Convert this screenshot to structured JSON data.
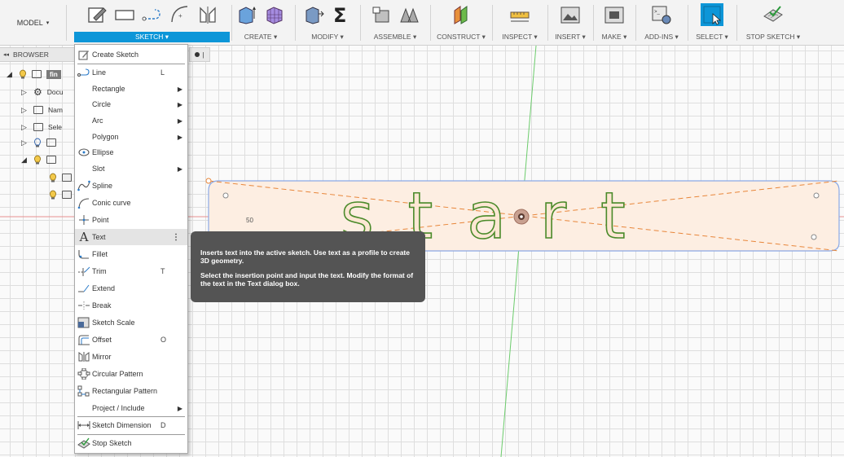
{
  "workspace": {
    "label": "MODEL",
    "arrow": "▾"
  },
  "toolbar": {
    "groups": [
      {
        "label": "SKETCH ▾",
        "icons": [
          "create-sketch-icon",
          "rectangle-icon",
          "line-icon",
          "arc-icon",
          "mirror-icon"
        ]
      },
      {
        "label": "CREATE ▾",
        "icons": [
          "extrude-icon",
          "box-grid-icon"
        ]
      },
      {
        "label": "MODIFY ▾",
        "icons": [
          "press-pull-icon",
          "sigma-icon"
        ]
      },
      {
        "label": "ASSEMBLE ▾",
        "icons": [
          "new-component-icon",
          "joint-icon"
        ]
      },
      {
        "label": "CONSTRUCT ▾",
        "icons": [
          "offset-plane-icon"
        ]
      },
      {
        "label": "INSPECT ▾",
        "icons": [
          "measure-icon"
        ]
      },
      {
        "label": "INSERT ▾",
        "icons": [
          "insert-image-icon"
        ]
      },
      {
        "label": "MAKE ▾",
        "icons": [
          "print-3d-icon"
        ]
      },
      {
        "label": "ADD-INS ▾",
        "icons": [
          "scripts-icon"
        ]
      },
      {
        "label": "SELECT ▾",
        "icons": [
          "select-icon"
        ]
      },
      {
        "label": "STOP SKETCH ▾",
        "icons": [
          "stop-sketch-icon"
        ]
      }
    ],
    "colors": {
      "active": "#0d96d8",
      "select_blue": "#0d96d8"
    }
  },
  "browser": {
    "title": "BROWSER",
    "collapse_glyph": "◂◂",
    "root_label": "fin",
    "items": [
      {
        "label": "Docu",
        "icon": "gear-icon"
      },
      {
        "label": "Nam",
        "icon": "folder-icon"
      },
      {
        "label": "Sele",
        "icon": "folder-icon"
      }
    ]
  },
  "menu": {
    "items": [
      {
        "label": "Create Sketch",
        "key": "",
        "submenu": false
      },
      {
        "label": "Line",
        "key": "L",
        "submenu": false
      },
      {
        "label": "Rectangle",
        "key": "",
        "submenu": true
      },
      {
        "label": "Circle",
        "key": "",
        "submenu": true
      },
      {
        "label": "Arc",
        "key": "",
        "submenu": true
      },
      {
        "label": "Polygon",
        "key": "",
        "submenu": true
      },
      {
        "label": "Ellipse",
        "key": "",
        "submenu": false
      },
      {
        "label": "Slot",
        "key": "",
        "submenu": true
      },
      {
        "label": "Spline",
        "key": "",
        "submenu": false
      },
      {
        "label": "Conic curve",
        "key": "",
        "submenu": false
      },
      {
        "label": "Point",
        "key": "",
        "submenu": false
      },
      {
        "label": "Text",
        "key": "",
        "submenu": false,
        "more": "⋮"
      },
      {
        "label": "Fillet",
        "key": "",
        "submenu": false
      },
      {
        "label": "Trim",
        "key": "T",
        "submenu": false
      },
      {
        "label": "Extend",
        "key": "",
        "submenu": false
      },
      {
        "label": "Break",
        "key": "",
        "submenu": false
      },
      {
        "label": "Sketch Scale",
        "key": "",
        "submenu": false
      },
      {
        "label": "Offset",
        "key": "O",
        "submenu": false
      },
      {
        "label": "Mirror",
        "key": "",
        "submenu": false
      },
      {
        "label": "Circular Pattern",
        "key": "",
        "submenu": false
      },
      {
        "label": "Rectangular Pattern",
        "key": "",
        "submenu": false
      },
      {
        "label": "Project / Include",
        "key": "",
        "submenu": true
      },
      {
        "label": "Sketch Dimension",
        "key": "D",
        "submenu": false
      },
      {
        "label": "Stop Sketch",
        "key": "",
        "submenu": false
      }
    ],
    "submenu_glyph": "▶",
    "highlighted": "Text"
  },
  "tooltip": {
    "line1": "Inserts text into the active sketch. Use text as a profile to create 3D geometry.",
    "line2": "Select the insertion point and input the text. Modify the format of the text in the Text dialog box."
  },
  "canvas": {
    "sketch_text": "start",
    "dimension_label": "50",
    "colors": {
      "text_outline": "#4a8a2a",
      "text_fill": "#fde7d3",
      "construction": "#e8863a",
      "profile": "#8aa9e6",
      "axis_red": "#e89090",
      "axis_green": "#6ccc6c"
    }
  }
}
